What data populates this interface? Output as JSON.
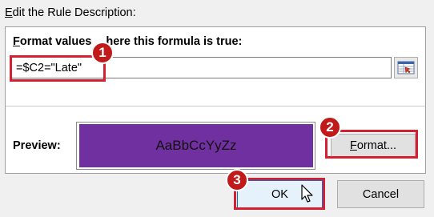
{
  "section": {
    "title_accel": "E",
    "title_rest": "dit the Rule Description:"
  },
  "formula": {
    "label_accel": "F",
    "label_mid": "ormat values ",
    "label_rest": "here this formula is true:",
    "value": "=$C2=\"Late\""
  },
  "preview": {
    "label": "Preview:",
    "sample": "AaBbCcYyZz",
    "fill_color": "#7030a0"
  },
  "buttons": {
    "format_accel": "F",
    "format_rest": "ormat...",
    "ok": "OK",
    "cancel": "Cancel"
  },
  "callouts": [
    "1",
    "2",
    "3"
  ],
  "colors": {
    "highlight": "#d42030",
    "badge": "#c01a1a",
    "dialog_bg": "#f0f0f0"
  },
  "icons": {
    "collapse": "collapse-dialog-icon",
    "cursor": "mouse-pointer-icon"
  }
}
